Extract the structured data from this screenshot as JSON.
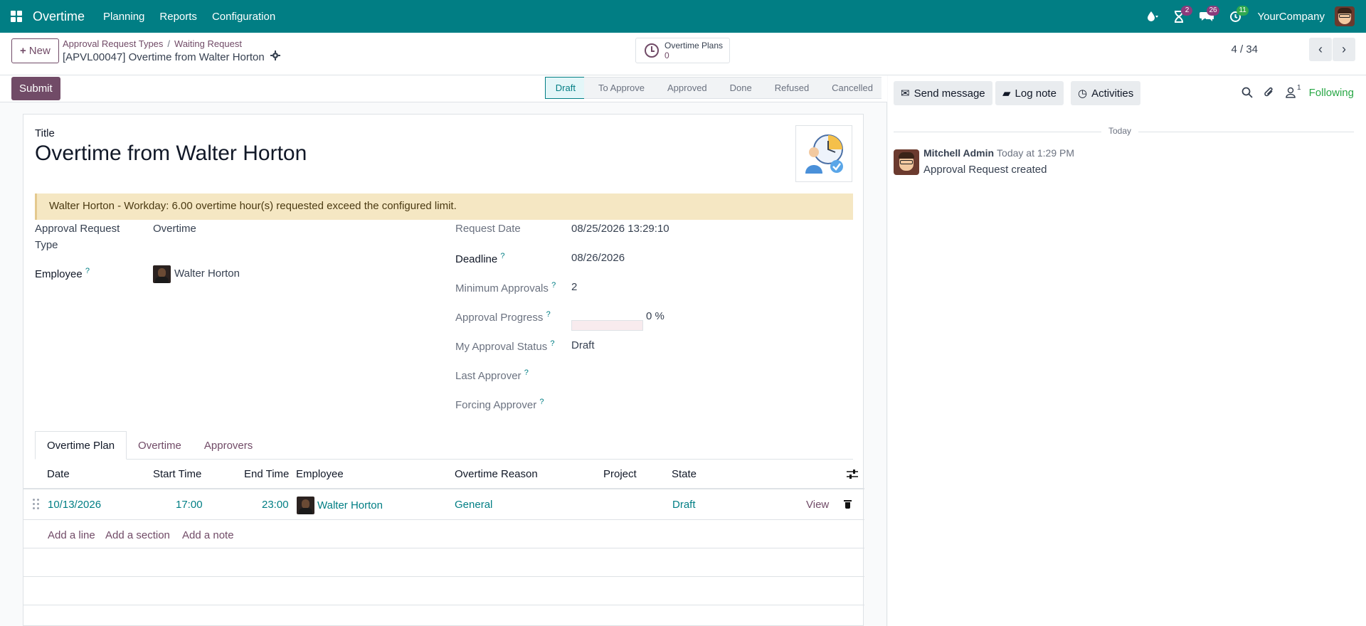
{
  "topbar": {
    "brand": "Overtime",
    "menu": [
      "Planning",
      "Reports",
      "Configuration"
    ],
    "activity_count": "2",
    "message_count": "26",
    "timer_count": "11",
    "company": "YourCompany",
    "colors": {
      "bar": "#017e84",
      "badge_purple": "#8b3c7c",
      "badge_green": "#2fa84f"
    }
  },
  "control": {
    "new_label": "New",
    "breadcrumbs": [
      "Approval Request Types",
      "Waiting Request"
    ],
    "record_title": "[APVL00047] Overtime from Walter Horton",
    "smart_button": {
      "label": "Overtime Plans",
      "value": "0"
    },
    "pager": "4 / 34"
  },
  "status": {
    "submit_label": "Submit",
    "stages": [
      "Draft",
      "To Approve",
      "Approved",
      "Done",
      "Refused",
      "Cancelled"
    ],
    "active_stage": "Draft"
  },
  "form": {
    "title_label": "Title",
    "title_value": "Overtime from Walter Horton",
    "warning": "Walter Horton - Workday: 6.00 overtime hour(s) requested exceed the configured limit.",
    "left": {
      "type_label_1": "Approval Request",
      "type_label_2": "Type",
      "type_value": "Overtime",
      "employee_label": "Employee",
      "employee_value": "Walter Horton"
    },
    "right": {
      "request_date_label": "Request Date",
      "request_date_value": "08/25/2026 13:29:10",
      "deadline_label": "Deadline",
      "deadline_value": "08/26/2026",
      "min_approvals_label": "Minimum Approvals",
      "min_approvals_value": "2",
      "progress_label": "Approval Progress",
      "progress_value": "0 %",
      "progress_fraction": 0,
      "my_status_label": "My Approval Status",
      "my_status_value": "Draft",
      "last_approver_label": "Last Approver",
      "forcing_approver_label": "Forcing Approver"
    },
    "help_mark": "?"
  },
  "tabs": {
    "items": [
      "Overtime Plan",
      "Overtime",
      "Approvers"
    ],
    "active": "Overtime Plan"
  },
  "table": {
    "headers": [
      "Date",
      "Start Time",
      "End Time",
      "Employee",
      "Overtime Reason",
      "Project",
      "State"
    ],
    "rows": [
      {
        "date": "10/13/2026",
        "start": "17:00",
        "end": "23:00",
        "employee": "Walter Horton",
        "reason": "General",
        "project": "",
        "state": "Draft",
        "action": "View"
      }
    ],
    "add_line": "Add a line",
    "add_section": "Add a section",
    "add_note": "Add a note"
  },
  "chatter": {
    "send_message": "Send message",
    "log_note": "Log note",
    "activities": "Activities",
    "followers_count": "1",
    "following": "Following",
    "separator": "Today",
    "author": "Mitchell Admin",
    "time": "Today at 1:29 PM",
    "body": "Approval Request created"
  }
}
